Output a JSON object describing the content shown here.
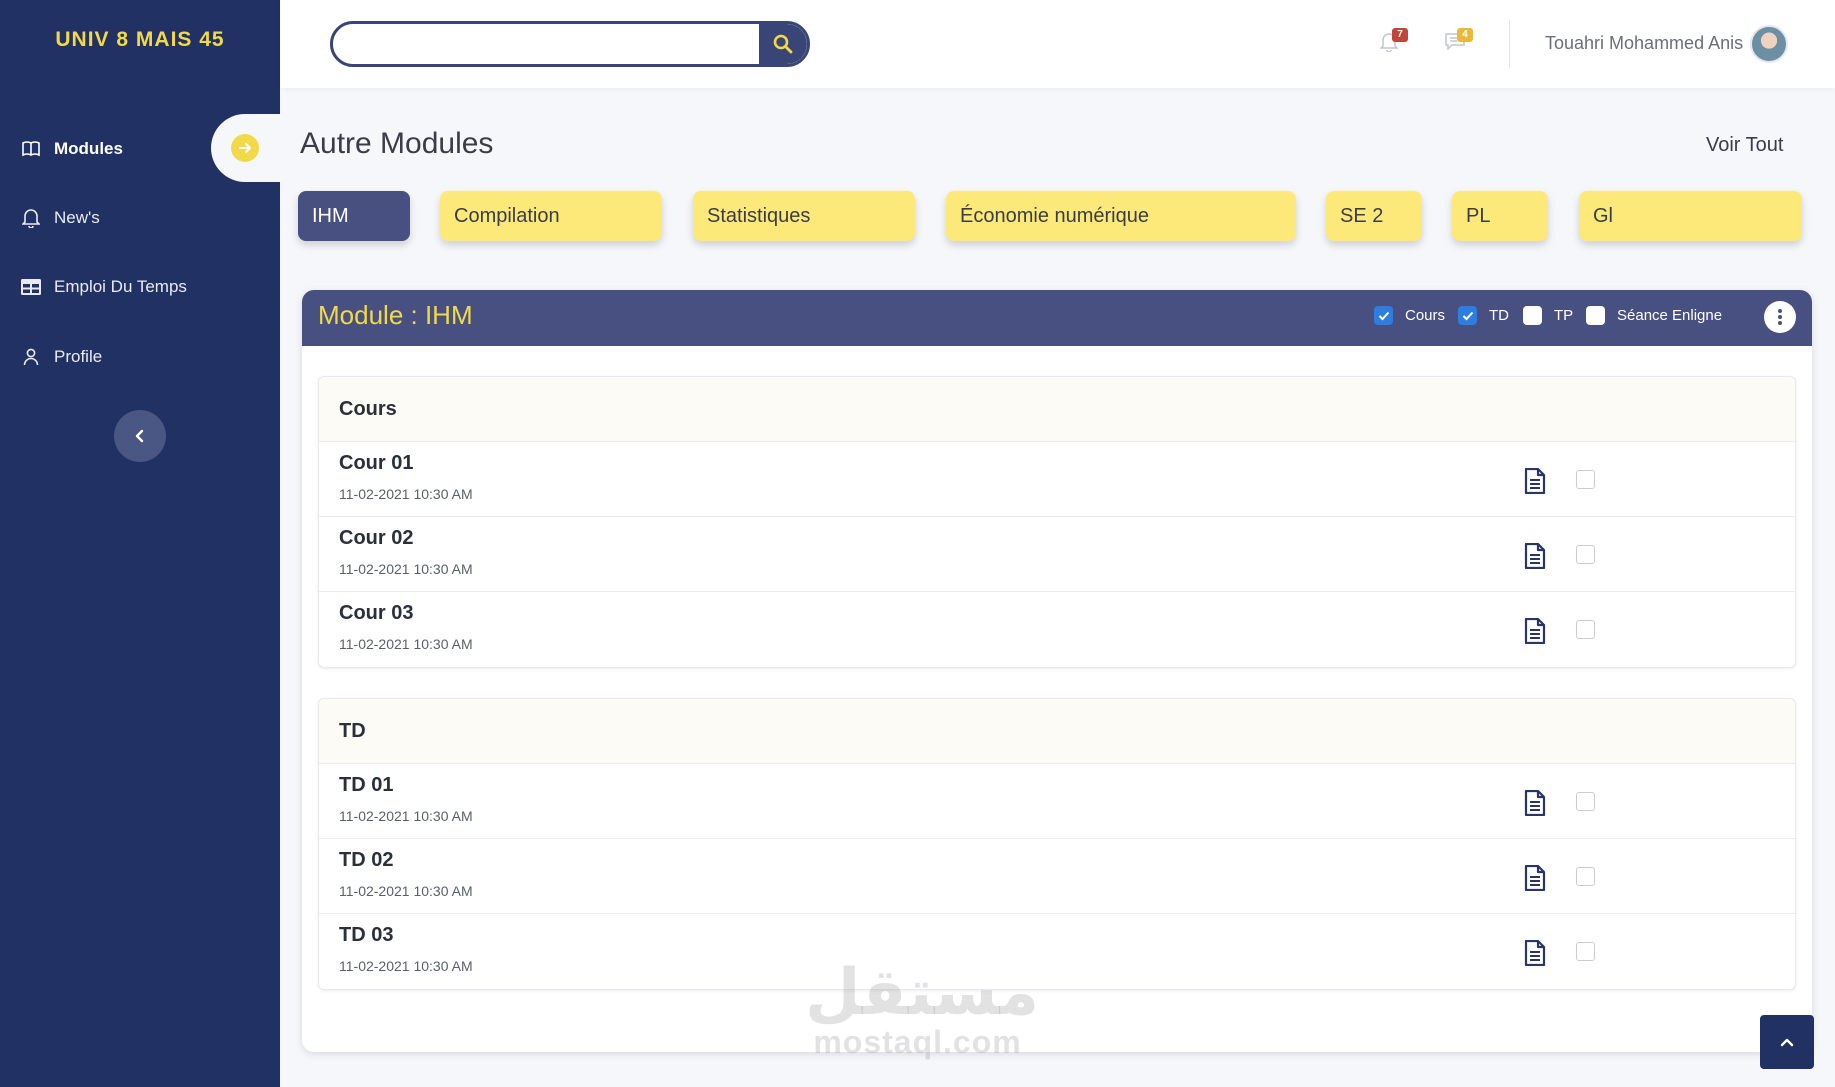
{
  "brand": "UNIV 8 MAIS 45",
  "sidebar": {
    "items": [
      {
        "label": "Modules",
        "icon": "book-open-icon"
      },
      {
        "label": "New's",
        "icon": "bell-icon"
      },
      {
        "label": "Emploi Du Temps",
        "icon": "table-icon"
      },
      {
        "label": "Profile",
        "icon": "user-icon"
      }
    ]
  },
  "header": {
    "search": {
      "value": "",
      "placeholder": ""
    },
    "notifications_count": "7",
    "messages_count": "4",
    "user_name": "Touahri Mohammed Anis"
  },
  "main": {
    "title": "Autre Modules",
    "see_all": "Voir Tout",
    "chips": [
      "IHM",
      "Compilation",
      "Statistiques",
      "Économie numérique",
      "SE 2",
      "PL",
      "Gl"
    ],
    "module": {
      "title": "Module : IHM",
      "filters": [
        {
          "label": "Cours",
          "checked": true
        },
        {
          "label": "TD",
          "checked": true
        },
        {
          "label": "TP",
          "checked": false
        },
        {
          "label": "Séance Enligne",
          "checked": false
        }
      ],
      "sections": [
        {
          "title": "Cours",
          "rows": [
            {
              "title": "Cour 01",
              "date": "11-02-2021  10:30 AM"
            },
            {
              "title": "Cour 02",
              "date": "11-02-2021  10:30 AM"
            },
            {
              "title": "Cour 03",
              "date": "11-02-2021  10:30 AM"
            }
          ]
        },
        {
          "title": "TD",
          "rows": [
            {
              "title": "TD 01",
              "date": "11-02-2021  10:30 AM"
            },
            {
              "title": "TD 02",
              "date": "11-02-2021  10:30 AM"
            },
            {
              "title": "TD 03",
              "date": "11-02-2021  10:30 AM"
            }
          ]
        }
      ]
    }
  },
  "watermark": {
    "arabic": "مستقل",
    "latin": "mostaql.com"
  },
  "colors": {
    "sidebar": "#213163",
    "accent": "#f2d94a",
    "primary": "#485081",
    "chip": "#fde97a"
  }
}
